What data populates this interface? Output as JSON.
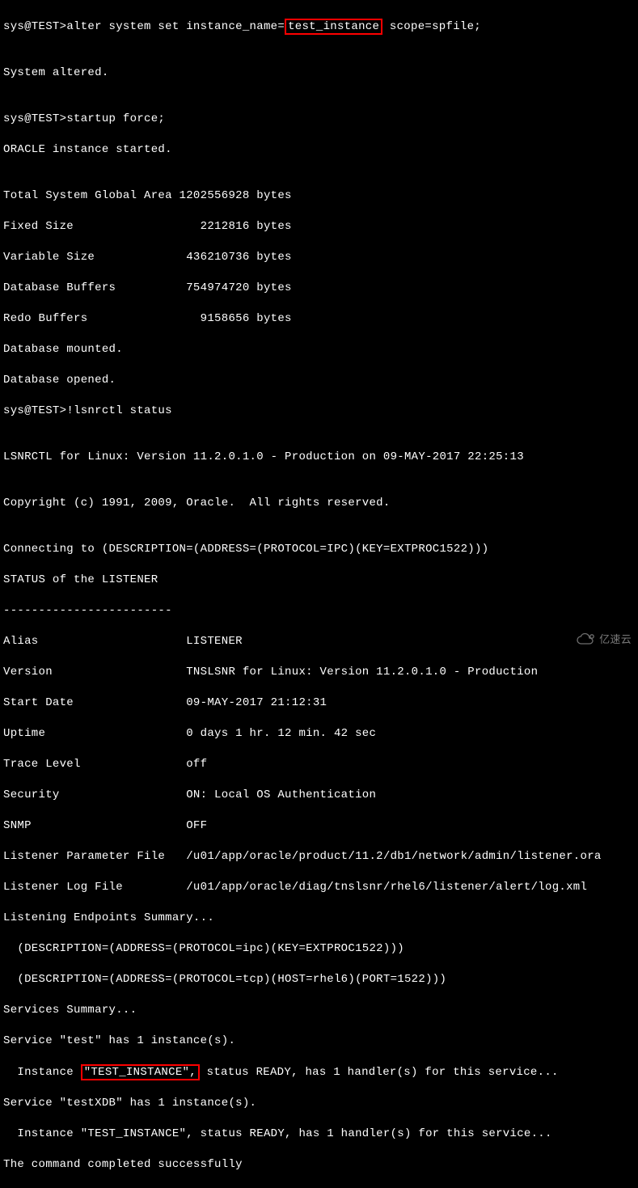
{
  "prompt1": "sys@TEST>",
  "cmd_alter_pre": "alter system set instance_name=",
  "cmd_alter_hl": "test_instance",
  "cmd_alter_post": " scope=spfile;",
  "blank": "",
  "system_altered": "System altered.",
  "cmd_startup": "startup force;",
  "instance_started": "ORACLE instance started.",
  "sga_total": "Total System Global Area 1202556928 bytes",
  "sga_fixed": "Fixed Size                  2212816 bytes",
  "sga_variable": "Variable Size             436210736 bytes",
  "sga_dbuf": "Database Buffers          754974720 bytes",
  "sga_redo": "Redo Buffers                9158656 bytes",
  "db_mounted": "Database mounted.",
  "db_opened": "Database opened.",
  "cmd_lsnrctl": "!lsnrctl status",
  "lsnrctl_banner": "LSNRCTL for Linux: Version 11.2.0.1.0 - Production on 09-MAY-2017 22:25:13",
  "copyright": "Copyright (c) 1991, 2009, Oracle.  All rights reserved.",
  "connecting": "Connecting to (DESCRIPTION=(ADDRESS=(PROTOCOL=IPC)(KEY=EXTPROC1522)))",
  "status_hdr": "STATUS of the LISTENER",
  "dashes": "------------------------",
  "alias_label": "Alias",
  "alias_value": "LISTENER",
  "version_label": "Version",
  "version_value": "TNSLSNR for Linux: Version 11.2.0.1.0 - Production",
  "startdate_label": "Start Date",
  "startdate_value": "09-MAY-2017 21:12:31",
  "uptime_label": "Uptime",
  "uptime_value": "0 days 1 hr. 12 min. 42 sec",
  "trace_label": "Trace Level",
  "trace_value": "off",
  "security_label": "Security",
  "security_value": "ON: Local OS Authentication",
  "snmp_label": "SNMP",
  "snmp_value": "OFF",
  "param_file_label": "Listener Parameter File",
  "param_file_value": "/u01/app/oracle/product/11.2/db1/network/admin/listener.ora",
  "log_file_label": "Listener Log File",
  "log_file_value": "/u01/app/oracle/diag/tnslsnr/rhel6/listener/alert/log.xml",
  "endpoints_hdr": "Listening Endpoints Summary...",
  "endpoint_ipc": "  (DESCRIPTION=(ADDRESS=(PROTOCOL=ipc)(KEY=EXTPROC1522)))",
  "endpoint_tcp": "  (DESCRIPTION=(ADDRESS=(PROTOCOL=tcp)(HOST=rhel6)(PORT=1522)))",
  "services_hdr": "Services Summary...",
  "service_test": "Service \"test\" has 1 instance(s).",
  "inst1_pre": "  Instance ",
  "inst1_hl": "\"TEST_INSTANCE\",",
  "inst1_post": " status READY, has 1 handler(s) for this service...",
  "service_testxdb": "Service \"testXDB\" has 1 instance(s).",
  "inst2": "  Instance \"TEST_INSTANCE\", status READY, has 1 handler(s) for this service...",
  "cmd_complete": "The command completed successfully",
  "watermark": "亿速云"
}
